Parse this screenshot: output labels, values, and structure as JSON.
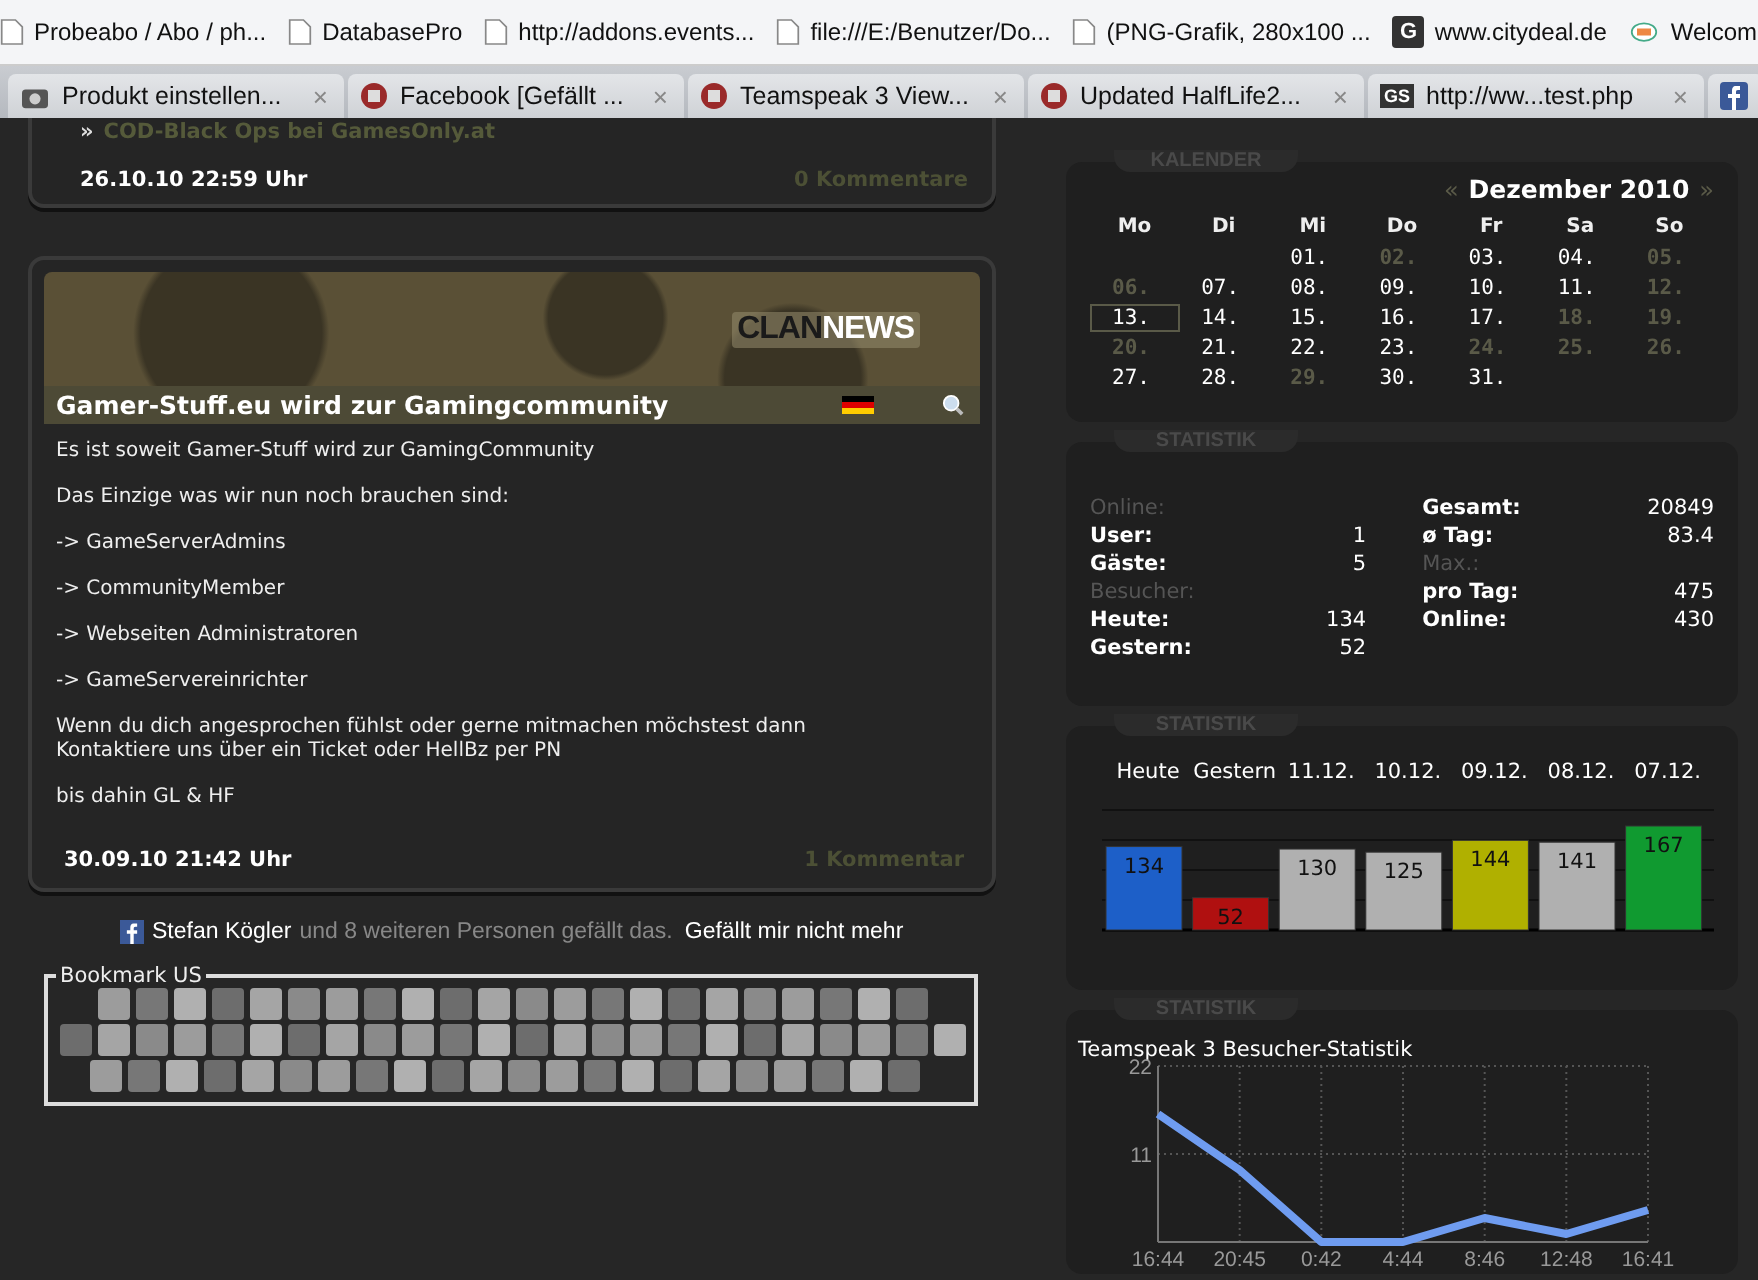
{
  "bookmarks_bar": [
    {
      "label": "Probeabo / Abo / ph...",
      "kind": "page"
    },
    {
      "label": "DatabasePro",
      "kind": "page"
    },
    {
      "label": "http://addons.events...",
      "kind": "page"
    },
    {
      "label": "file:///E:/Benutzer/Do...",
      "kind": "page"
    },
    {
      "label": "(PNG-Grafik, 280x100 ...",
      "kind": "page"
    },
    {
      "label": "www.citydeal.de",
      "kind": "letter",
      "letter": "G"
    },
    {
      "label": "Welcom",
      "kind": "logo"
    }
  ],
  "tabs": [
    {
      "label": "Produkt einstellen...",
      "kind": "camera",
      "close": "×"
    },
    {
      "label": "Facebook [Gefällt ...",
      "kind": "badge",
      "close": "×"
    },
    {
      "label": "Teamspeak 3 View...",
      "kind": "badge",
      "close": "×"
    },
    {
      "label": "Updated HalfLife2...",
      "kind": "badge",
      "close": "×"
    },
    {
      "label": "http://ww...test.php",
      "kind": "text",
      "badge_text": "GS",
      "close": "×"
    },
    {
      "kind": "facebook"
    }
  ],
  "previous_news": {
    "bullet": "»",
    "link": "COD-Black Ops bei GamesOnly.at",
    "date": "26.10.10 22:59 Uhr",
    "comments": "0 Kommentare"
  },
  "news": {
    "banner": {
      "brand_dark": "CLAN",
      "brand_light": "NEWS"
    },
    "title": "Gamer-Stuff.eu wird zur Gamingcommunity",
    "paragraphs": [
      "Es ist soweit Gamer-Stuff wird zur GamingCommunity",
      "Das Einzige was wir nun noch brauchen sind:",
      "-> GameServerAdmins",
      "-> CommunityMember",
      "-> Webseiten Administratoren",
      "-> GameServereinrichter",
      "Wenn du dich angesprochen fühlst oder gerne mitmachen möchstest dann Kontaktiere uns über ein Ticket oder HellBz per PN",
      "bis dahin GL & HF"
    ],
    "date": "30.09.10 21:42 Uhr",
    "comments": "1 Kommentar"
  },
  "facebook_like": {
    "name": "Stefan Kögler",
    "text": "und 8 weiteren Personen gefällt das.",
    "action": "Gefällt mir nicht mehr"
  },
  "bookmark_us": {
    "legend": "Bookmark US"
  },
  "calendar": {
    "heading": "KALENDER",
    "prev": "«",
    "month": "Dezember 2010",
    "next": "»",
    "weekdays": [
      "Mo",
      "Di",
      "Mi",
      "Do",
      "Fr",
      "Sa",
      "So"
    ],
    "weeks": [
      {
        "days": [
          {
            "label": "01.",
            "muted": false,
            "selected": false
          },
          {
            "label": "02.",
            "muted": true,
            "selected": false
          },
          {
            "label": "03.",
            "muted": false,
            "selected": false
          },
          {
            "label": "04.",
            "muted": false,
            "selected": false
          },
          {
            "label": "05.",
            "muted": true,
            "selected": false
          }
        ]
      },
      {
        "days": [
          {
            "label": "06.",
            "muted": true,
            "selected": false
          },
          {
            "label": "07.",
            "muted": false,
            "selected": false
          },
          {
            "label": "08.",
            "muted": false,
            "selected": false
          },
          {
            "label": "09.",
            "muted": false,
            "selected": false
          },
          {
            "label": "10.",
            "muted": false,
            "selected": false
          },
          {
            "label": "11.",
            "muted": false,
            "selected": false
          },
          {
            "label": "12.",
            "muted": true,
            "selected": false
          }
        ]
      },
      {
        "days": [
          {
            "label": "13.",
            "muted": false,
            "selected": true
          },
          {
            "label": "14.",
            "muted": false,
            "selected": false
          },
          {
            "label": "15.",
            "muted": false,
            "selected": false
          },
          {
            "label": "16.",
            "muted": false,
            "selected": false
          },
          {
            "label": "17.",
            "muted": false,
            "selected": false
          },
          {
            "label": "18.",
            "muted": true,
            "selected": false
          },
          {
            "label": "19.",
            "muted": true,
            "selected": false
          }
        ]
      },
      {
        "days": [
          {
            "label": "20.",
            "muted": true,
            "selected": false
          },
          {
            "label": "21.",
            "muted": false,
            "selected": false
          },
          {
            "label": "22.",
            "muted": false,
            "selected": false
          },
          {
            "label": "23.",
            "muted": false,
            "selected": false
          },
          {
            "label": "24.",
            "muted": true,
            "selected": false
          },
          {
            "label": "25.",
            "muted": true,
            "selected": false
          },
          {
            "label": "26.",
            "muted": true,
            "selected": false
          }
        ]
      },
      {
        "days": [
          {
            "label": "27.",
            "muted": false,
            "selected": false
          },
          {
            "label": "28.",
            "muted": false,
            "selected": false
          },
          {
            "label": "29.",
            "muted": true,
            "selected": false
          },
          {
            "label": "30.",
            "muted": false,
            "selected": false
          },
          {
            "label": "31.",
            "muted": false,
            "selected": false
          }
        ]
      }
    ]
  },
  "statistics": {
    "heading": "STATISTIK",
    "columns": [
      {
        "items": [
          {
            "kind": "heading",
            "label": "Online:"
          },
          {
            "kind": "row",
            "label": "User:",
            "value": "1"
          },
          {
            "kind": "row",
            "label": "Gäste:",
            "value": "5"
          },
          {
            "kind": "heading",
            "label": "Besucher:"
          },
          {
            "kind": "row",
            "label": "Heute:",
            "value": "134"
          },
          {
            "kind": "row",
            "label": "Gestern:",
            "value": "52"
          }
        ]
      },
      {
        "items": [
          {
            "kind": "row",
            "label": "Gesamt:",
            "value": "20849"
          },
          {
            "kind": "row",
            "label": "ø Tag:",
            "value": "83.4"
          },
          {
            "kind": "heading",
            "label": "Max.:"
          },
          {
            "kind": "row",
            "label": "pro Tag:",
            "value": "475"
          },
          {
            "kind": "row",
            "label": "Online:",
            "value": "430"
          }
        ]
      }
    ]
  },
  "visitor_chart": {
    "heading": "STATISTIK",
    "chart_data": {
      "type": "bar",
      "categories": [
        "Heute",
        "Gestern",
        "11.12.",
        "10.12.",
        "09.12.",
        "08.12.",
        "07.12."
      ],
      "values": [
        134,
        52,
        130,
        125,
        144,
        141,
        167
      ],
      "data_labels": true
    }
  },
  "teamspeak_chart": {
    "heading": "STATISTIK",
    "title": "Teamspeak 3 Besucher-Statistik",
    "chart_data": {
      "type": "line",
      "categories": [
        "16:44",
        "20:45",
        "0:42",
        "4:44",
        "8:46",
        "12:48",
        "16:41"
      ],
      "values": [
        16,
        9,
        0,
        0,
        3,
        1,
        4
      ],
      "ylim": [
        0,
        22
      ],
      "yticks": [
        11,
        22
      ],
      "grid": true
    }
  }
}
